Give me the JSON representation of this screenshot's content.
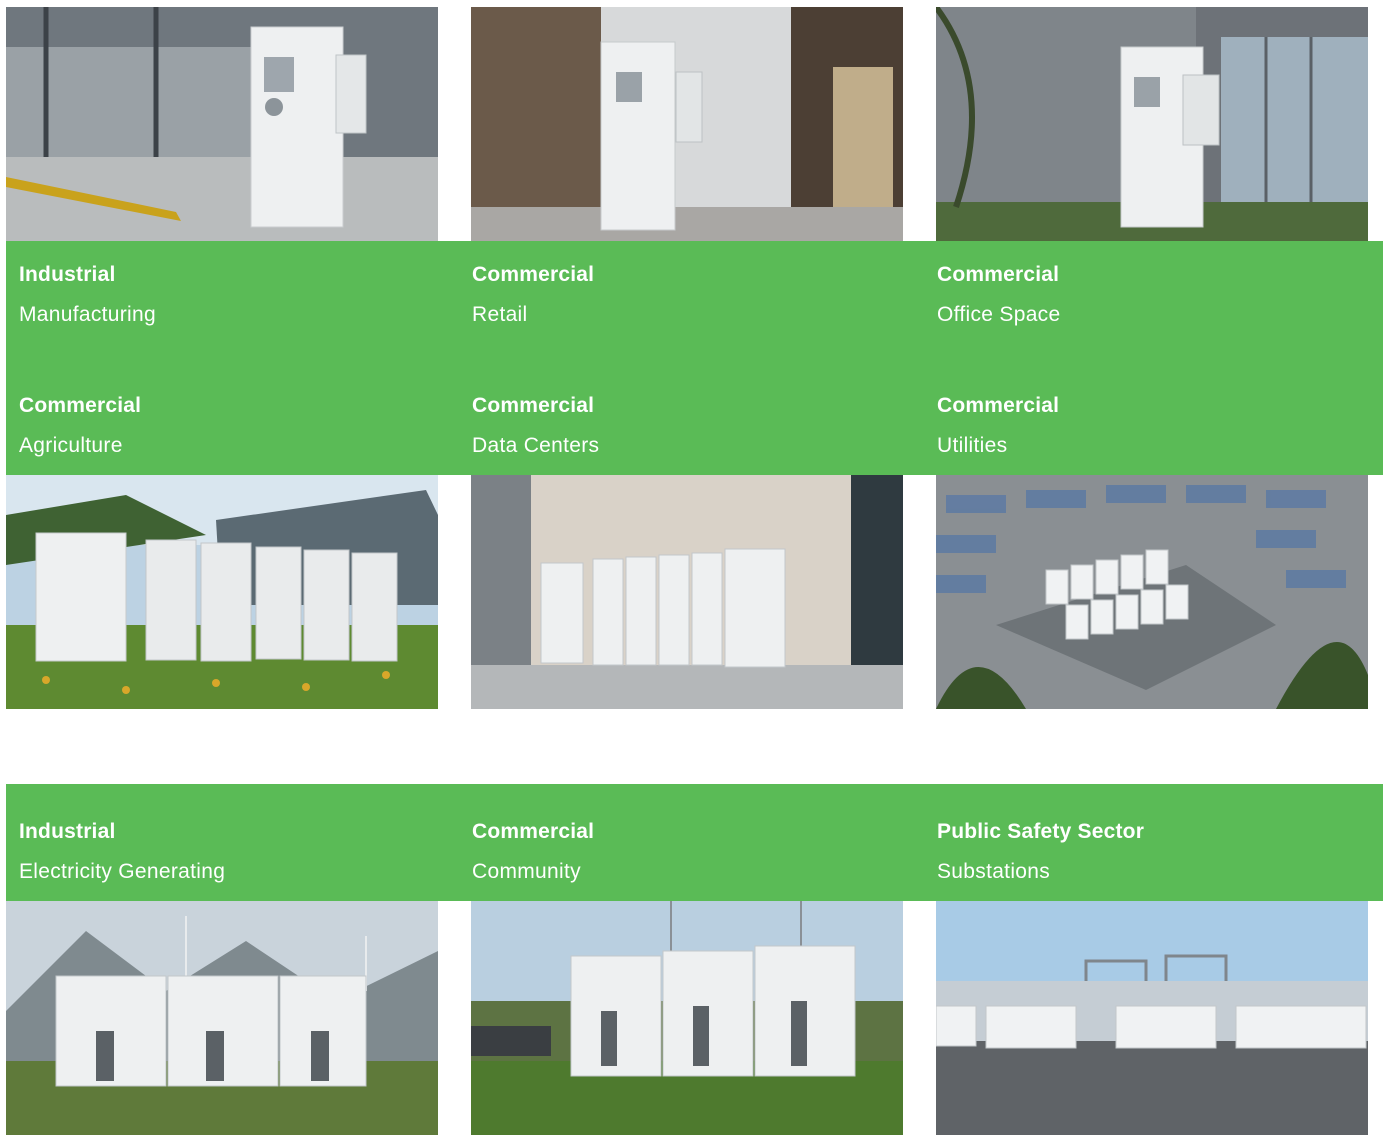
{
  "tiles": [
    {
      "category": "Industrial",
      "name": "Manufacturing"
    },
    {
      "category": "Commercial",
      "name": "Retail"
    },
    {
      "category": "Commercial",
      "name": "Office Space"
    },
    {
      "category": "Commercial",
      "name": "Agriculture"
    },
    {
      "category": "Commercial",
      "name": "Data Centers"
    },
    {
      "category": "Commercial",
      "name": "Utilities"
    },
    {
      "category": "Industrial",
      "name": "Electricity Generating"
    },
    {
      "category": "Commercial",
      "name": "Community"
    },
    {
      "category": "Public Safety Sector",
      "name": "Substations"
    }
  ],
  "colors": {
    "band": "#4cb548",
    "label_text": "#ffffff"
  }
}
